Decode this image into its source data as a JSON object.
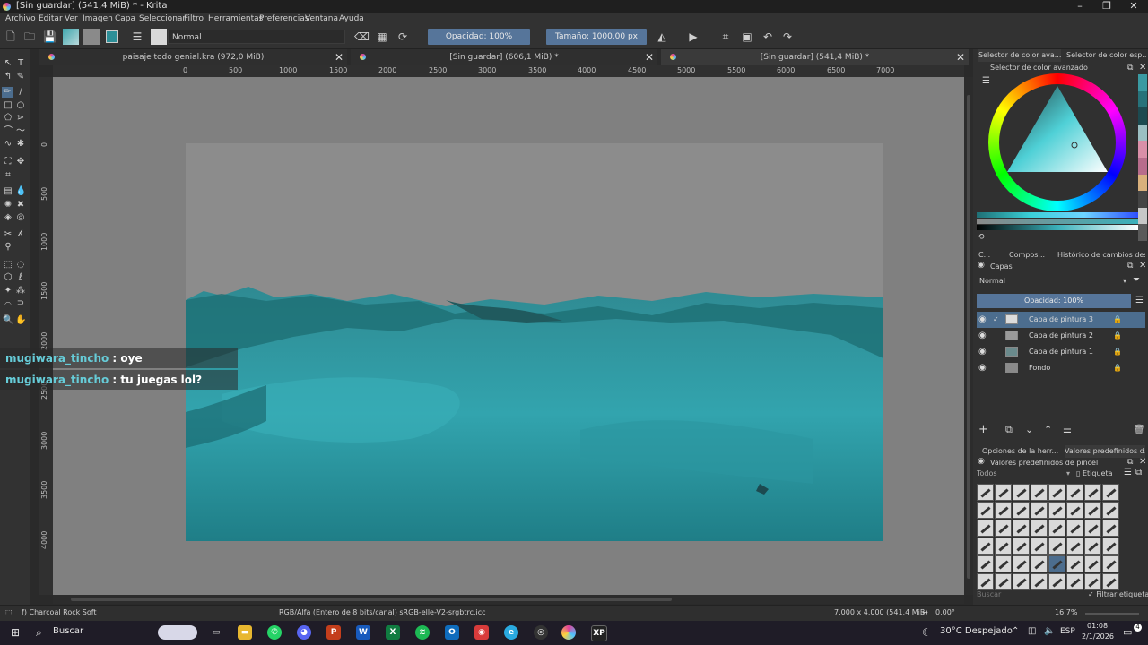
{
  "window": {
    "title": "[Sin guardar]  (541,4 MiB) * - Krita",
    "minimize": "–",
    "restore": "❐",
    "close": "✕"
  },
  "menu": [
    "Archivo",
    "Editar",
    "Ver",
    "Imagen",
    "Capa",
    "Seleccionar",
    "Filtro",
    "Herramientas",
    "Preferencias",
    "Ventana",
    "Ayuda"
  ],
  "toolbar": {
    "blend_mode": "Normal",
    "opacity": "Opacidad: 100%",
    "size": "Tamaño: 1000,00 px"
  },
  "tabs": [
    {
      "label": "paisaje todo genial.kra (972,0 MiB)",
      "close": "✕"
    },
    {
      "label": "[Sin guardar]  (606,1 MiB) *",
      "close": "✕"
    },
    {
      "label": "[Sin guardar]  (541,4 MiB) *",
      "close": "✕"
    }
  ],
  "ruler": {
    "h_ticks": [
      "0",
      "500",
      "1000",
      "1500",
      "2000",
      "2500",
      "3000",
      "3500",
      "4000",
      "4500",
      "5000",
      "5500",
      "6000",
      "6500",
      "7000"
    ],
    "v_ticks": [
      "0",
      "500",
      "1000",
      "1500",
      "2000",
      "2500",
      "3000",
      "3500",
      "4000"
    ]
  },
  "chat": [
    {
      "user": "mugiwara_tincho",
      "message": " : oye"
    },
    {
      "user": "mugiwara_tincho",
      "message": " : tu juegas lol?"
    }
  ],
  "color_docker": {
    "tabs": [
      "Selector de color ava...",
      "Selector de color esp..."
    ],
    "header": "Selector de color avanzado",
    "palette": [
      "#3a9aa2",
      "#27727a",
      "#1c4a50",
      "#9bbfc2",
      "#d98fa8",
      "#b76d8c",
      "#d9b07c",
      "#444444",
      "#c7c7c7",
      "#5a5a5a"
    ]
  },
  "layers_docker": {
    "tabs": [
      "C...",
      "Compos...",
      "Histórico de cambios des..."
    ],
    "header": "Capas",
    "blend": "Normal",
    "opacity": "Opacidad:  100%",
    "layers": [
      {
        "name": "Capa de pintura 3",
        "selected": true
      },
      {
        "name": "Capa de pintura 2",
        "selected": false
      },
      {
        "name": "Capa de pintura 1",
        "selected": false
      },
      {
        "name": "Fondo",
        "selected": false
      }
    ]
  },
  "brush_docker": {
    "tabs": [
      "Opciones de la herr...",
      "Valores predefinidos d..."
    ],
    "header": "Valores predefinidos de pincel",
    "filter": "Todos",
    "tag": "Etiqueta",
    "search_placeholder": "Buscar",
    "filter_tag": "Filtrar etiqueta"
  },
  "status": {
    "brush": "f) Charcoal Rock Soft",
    "color_space": "RGB/Alfa (Entero de 8 bits/canal)  sRGB-elle-V2-srgbtrc.icc",
    "dimensions": "7.000 x 4.000 (541,4 MiB)",
    "rotation": "0,00°",
    "zoom": "16,7%"
  },
  "taskbar": {
    "search": "Buscar",
    "weather": "30°C  Despejado",
    "lang": "ESP",
    "time": "01:08",
    "date": "2/1/2026",
    "notifications": "4"
  }
}
